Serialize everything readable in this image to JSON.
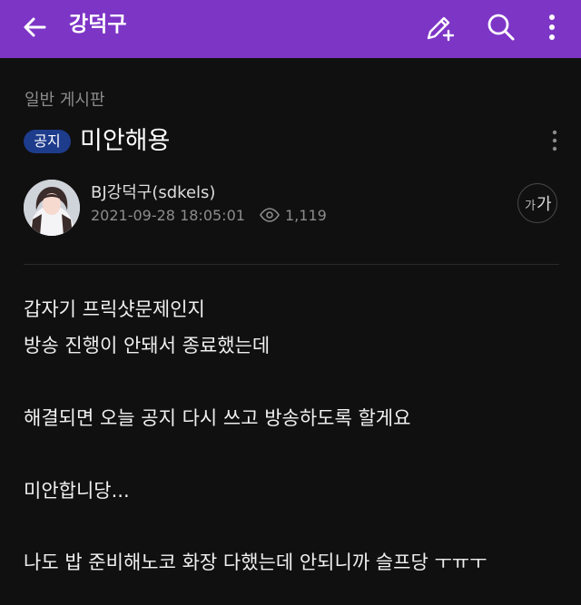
{
  "topbar": {
    "title": "강덕구",
    "back_icon": "arrow-left-icon",
    "write_icon": "pencil-plus-icon",
    "search_icon": "search-icon",
    "more_icon": "more-vertical-icon",
    "background": "#7d35c6"
  },
  "post": {
    "category": "일반 게시판",
    "badge": "공지",
    "title": "미안해용",
    "author": "BJ강덕구(sdkels)",
    "date": "2021-09-28 18:05:01",
    "views": "1,119",
    "font_size_button": {
      "small": "가",
      "big": "가"
    },
    "body_lines": [
      "갑자기 프릭샷문제인지",
      "방송 진행이 안돼서 종료했는데",
      "해결되면 오늘 공지 다시 쓰고 방송하도록 할게요",
      "미안합니당...",
      "나도 밥 준비해노코 화장 다했는데 안되니까 슬프당 ㅜㅠㅜ"
    ]
  }
}
